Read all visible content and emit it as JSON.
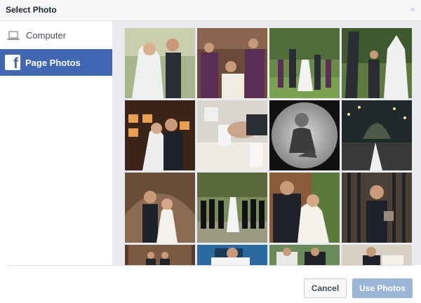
{
  "dialog": {
    "title": "Select Photo",
    "close_glyph": "×"
  },
  "sidebar": {
    "items": [
      {
        "label": "Computer",
        "icon": "laptop-icon",
        "selected": false
      },
      {
        "label": "Page Photos",
        "icon": "facebook-icon",
        "selected": true
      }
    ]
  },
  "photos": {
    "count": 16,
    "columns": 4
  },
  "footer": {
    "cancel_label": "Cancel",
    "use_label": "Use Photos"
  },
  "colors": {
    "selected_nav": "#4267b2",
    "use_button_disabled": "#9cb4d8",
    "content_bg": "#e9ebee"
  }
}
